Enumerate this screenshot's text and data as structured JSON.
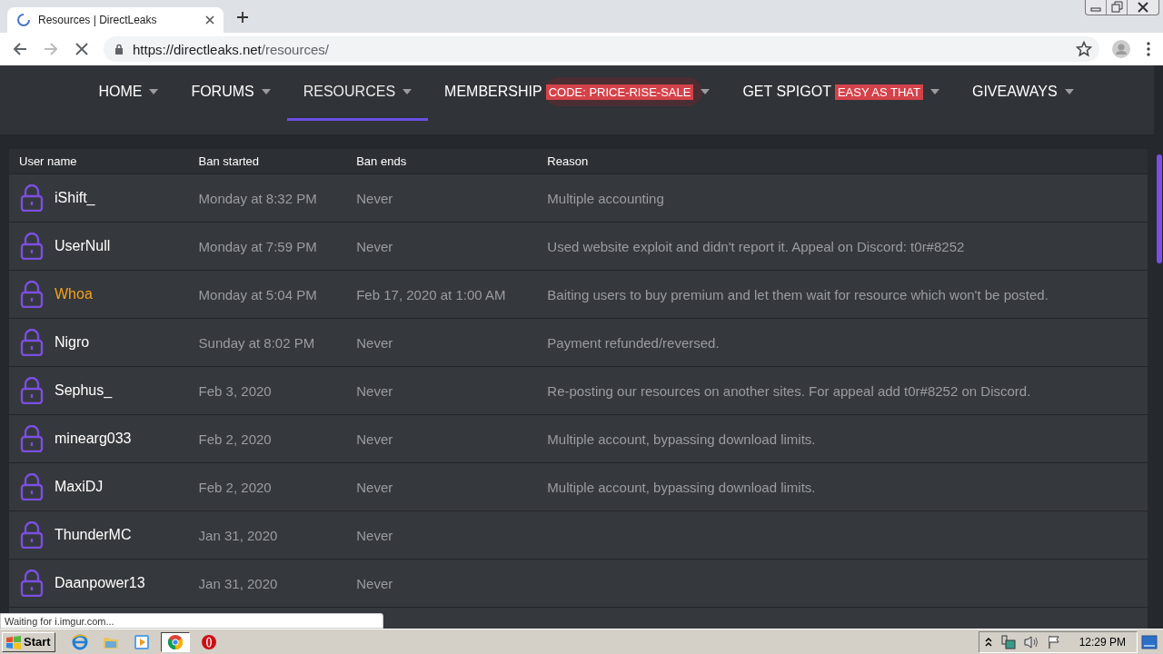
{
  "browser": {
    "tab_title": "Resources | DirectLeaks",
    "url_host": "https://directleaks.net",
    "url_path": "/resources/",
    "loading": true
  },
  "nav": [
    {
      "label": "HOME",
      "selected": false
    },
    {
      "label": "FORUMS",
      "selected": false
    },
    {
      "label": "RESOURCES",
      "selected": true
    },
    {
      "label": "MEMBERSHIP",
      "badge": "CODE: PRICE-RISE-SALE",
      "selected": false
    },
    {
      "label": "GET SPIGOT",
      "badge": "EASY AS THAT",
      "selected": false
    },
    {
      "label": "GIVEAWAYS",
      "selected": false
    }
  ],
  "table": {
    "columns": [
      "User name",
      "Ban started",
      "Ban ends",
      "Reason"
    ],
    "rows": [
      {
        "user": "iShift_",
        "color": "#ffffff",
        "started": "Monday at 8:32 PM",
        "ends": "Never",
        "reason": "Multiple accounting"
      },
      {
        "user": "UserNull",
        "color": "#ffffff",
        "started": "Monday at 7:59 PM",
        "ends": "Never",
        "reason": "Used website exploit and didn't report it. Appeal on Discord: t0r#8252"
      },
      {
        "user": "Whoa",
        "color": "#f5a31a",
        "started": "Monday at 5:04 PM",
        "ends": "Feb 17, 2020 at 1:00 AM",
        "reason": "Baiting users to buy premium and let them wait for resource which won't be posted."
      },
      {
        "user": "Nigro",
        "color": "#ffffff",
        "started": "Sunday at 8:02 PM",
        "ends": "Never",
        "reason": "Payment refunded/reversed."
      },
      {
        "user": "Sephus_",
        "color": "#ffffff",
        "started": "Feb 3, 2020",
        "ends": "Never",
        "reason": "Re-posting our resources on another sites. For appeal add t0r#8252 on Discord."
      },
      {
        "user": "minearg033",
        "color": "#ffffff",
        "started": "Feb 2, 2020",
        "ends": "Never",
        "reason": "Multiple account, bypassing download limits."
      },
      {
        "user": "MaxiDJ",
        "color": "#ffffff",
        "started": "Feb 2, 2020",
        "ends": "Never",
        "reason": "Multiple account, bypassing download limits."
      },
      {
        "user": "ThunderMC",
        "color": "#ffffff",
        "started": "Jan 31, 2020",
        "ends": "Never"
      },
      {
        "user": "Daanpower13",
        "color": "#ffffff",
        "started": "Jan 31, 2020",
        "ends": "Never"
      }
    ]
  },
  "status_bubble": "Waiting for i.imgur.com...",
  "taskbar": {
    "start": "Start",
    "apps": [
      {
        "kind": "ie",
        "selected": false
      },
      {
        "kind": "folder",
        "selected": false
      },
      {
        "kind": "media",
        "selected": false
      },
      {
        "kind": "chrome",
        "selected": true
      },
      {
        "kind": "opera",
        "selected": false
      }
    ],
    "clock": "12:29 PM"
  }
}
